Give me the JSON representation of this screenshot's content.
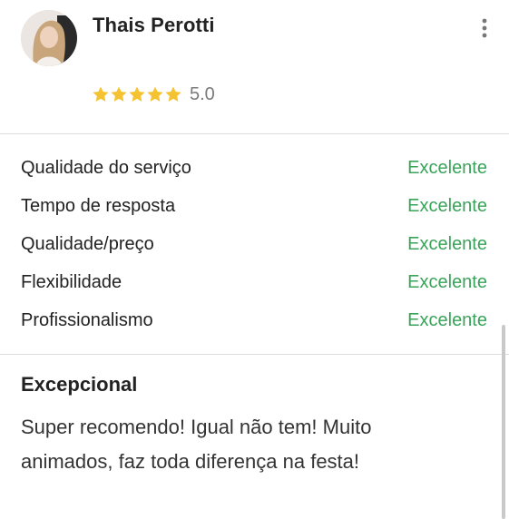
{
  "reviewer": {
    "name": "Thais Perotti"
  },
  "rating": {
    "stars": 5,
    "max_stars": 5,
    "score_label": "5.0",
    "star_color": "#f5c332"
  },
  "criteria": [
    {
      "label": "Qualidade do serviço",
      "value": "Excelente"
    },
    {
      "label": "Tempo de resposta",
      "value": "Excelente"
    },
    {
      "label": "Qualidade/preço",
      "value": "Excelente"
    },
    {
      "label": "Flexibilidade",
      "value": "Excelente"
    },
    {
      "label": "Profissionalismo",
      "value": "Excelente"
    }
  ],
  "review": {
    "title": "Excepcional",
    "text": "Super recomendo! Igual não tem! Muito animados, faz toda diferença na festa!"
  },
  "colors": {
    "accent_green": "#3aa35a",
    "divider": "#dcdcdc"
  },
  "icons": {
    "more": "more-vertical-icon",
    "star": "star-icon"
  }
}
